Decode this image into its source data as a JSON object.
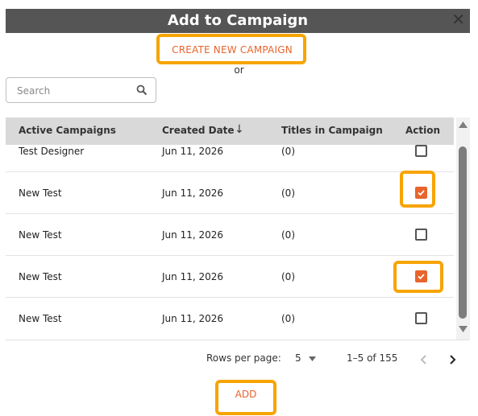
{
  "dialog": {
    "title": "Add to Campaign",
    "close_glyph": "✕",
    "create_label": "CREATE NEW CAMPAIGN",
    "or_text": "or"
  },
  "search": {
    "placeholder": "Search"
  },
  "table": {
    "columns": [
      "Active Campaigns",
      "Created Date",
      "Titles in Campaign",
      "Action"
    ],
    "sort_indicator": "↓",
    "rows": [
      {
        "name": "Test Designer",
        "date": "Jun 11, 2026",
        "titles": "(0)",
        "checked": false
      },
      {
        "name": "New Test",
        "date": "Jun 11, 2026",
        "titles": "(0)",
        "checked": true
      },
      {
        "name": "New Test",
        "date": "Jun 11, 2026",
        "titles": "(0)",
        "checked": false
      },
      {
        "name": "New Test",
        "date": "Jun 11, 2026",
        "titles": "(0)",
        "checked": true
      },
      {
        "name": "New Test",
        "date": "Jun 11, 2026",
        "titles": "(0)",
        "checked": false
      }
    ]
  },
  "pagination": {
    "rows_label": "Rows per page:",
    "rows_value": "5",
    "range": "1–5 of 155"
  },
  "footer": {
    "add_label": "ADD"
  },
  "colors": {
    "accent": "#e8642c",
    "highlight": "#f7a400",
    "titlebar": "#555555",
    "header_bg": "#d9d9d9"
  }
}
